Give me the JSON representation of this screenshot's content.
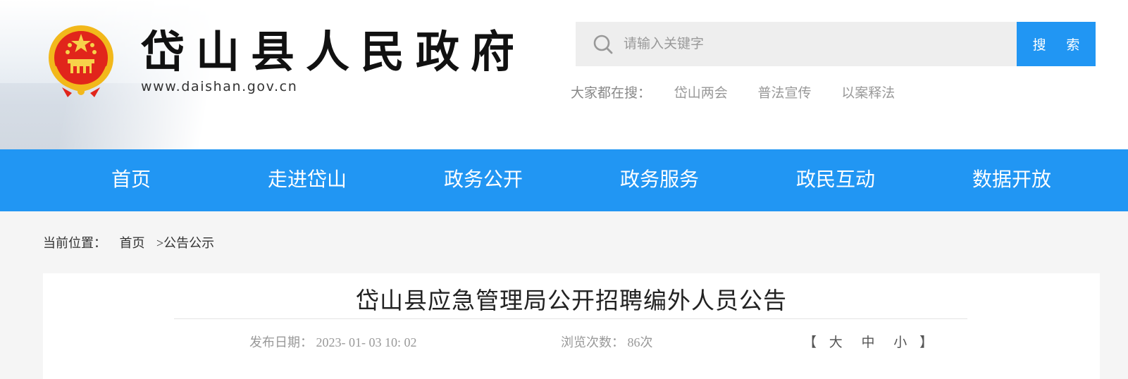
{
  "header": {
    "title": "岱山县人民政府",
    "url": "www.daishan.gov.cn"
  },
  "search": {
    "placeholder": "请输入关键字",
    "button_label": "搜 索",
    "hot_label": "大家都在搜：",
    "hot_links": [
      "岱山两会",
      "普法宣传",
      "以案释法"
    ]
  },
  "nav": {
    "items": [
      "首页",
      "走进岱山",
      "政务公开",
      "政务服务",
      "政民互动",
      "数据开放"
    ]
  },
  "breadcrumb": {
    "label": "当前位置：",
    "home": "首页",
    "current": ">公告公示"
  },
  "article": {
    "title": "岱山县应急管理局公开招聘编外人员公告",
    "date_label": "发布日期：",
    "date": "2023- 01- 03 10: 02",
    "views_label": "浏览次数：",
    "views": "86次",
    "font_size": {
      "open": "【",
      "large": "大",
      "medium": "中",
      "small": "小",
      "close": "】"
    }
  },
  "colors": {
    "brand_blue": "#2196f3",
    "emblem_red": "#e1251b",
    "emblem_gold": "#f2b81b"
  }
}
